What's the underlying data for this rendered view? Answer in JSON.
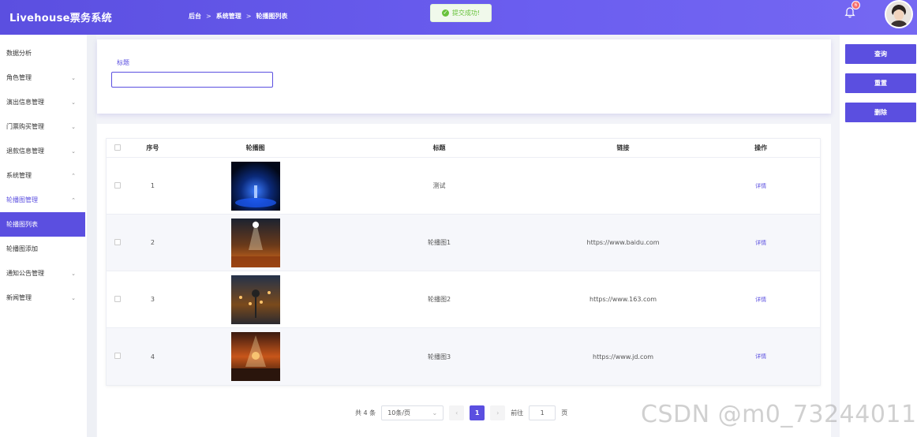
{
  "app": {
    "title": "Livehouse票务系统"
  },
  "breadcrumb": {
    "home": "后台",
    "sep1": ">",
    "section": "系统管理",
    "sep2": ">",
    "page": "轮播图列表"
  },
  "toast": {
    "text": "提交成功!",
    "icon": "check-circle-icon",
    "color": "#67c23a"
  },
  "notifications": {
    "count": "6"
  },
  "sidebar": {
    "items": [
      {
        "label": "数据分析",
        "arrow": ""
      },
      {
        "label": "角色管理",
        "arrow": "⌄"
      },
      {
        "label": "演出信息管理",
        "arrow": "⌄"
      },
      {
        "label": "门票购买管理",
        "arrow": "⌄"
      },
      {
        "label": "退款信息管理",
        "arrow": "⌄"
      },
      {
        "label": "系统管理",
        "arrow": "⌃"
      },
      {
        "label": "轮播图管理",
        "arrow": "⌃"
      },
      {
        "label": "轮播图列表",
        "arrow": ""
      },
      {
        "label": "轮播图添加",
        "arrow": ""
      },
      {
        "label": "通知公告管理",
        "arrow": "⌄"
      },
      {
        "label": "新闻管理",
        "arrow": "⌄"
      }
    ]
  },
  "search": {
    "label": "标题",
    "value": ""
  },
  "actions": {
    "query": "查询",
    "reset": "重置",
    "delete": "删除"
  },
  "table": {
    "headers": {
      "index": "序号",
      "image": "轮播图",
      "title": "标题",
      "link": "链接",
      "op": "操作"
    },
    "rows": [
      {
        "index": "1",
        "title": "测试",
        "link": "",
        "op": "详情"
      },
      {
        "index": "2",
        "title": "轮播图1",
        "link": "https://www.baidu.com",
        "op": "详情"
      },
      {
        "index": "3",
        "title": "轮播图2",
        "link": "https://www.163.com",
        "op": "详情"
      },
      {
        "index": "4",
        "title": "轮播图3",
        "link": "https://www.jd.com",
        "op": "详情"
      }
    ]
  },
  "pagination": {
    "total": "共 4 条",
    "page_size": "10条/页",
    "prev": "‹",
    "current": "1",
    "next": "›",
    "goto_label": "前往",
    "goto_value": "1",
    "goto_suffix": "页"
  },
  "watermark": {
    "text": "CSDN @m0_73244011"
  },
  "colors": {
    "accent": "#5b4fe0",
    "success": "#67c23a"
  }
}
